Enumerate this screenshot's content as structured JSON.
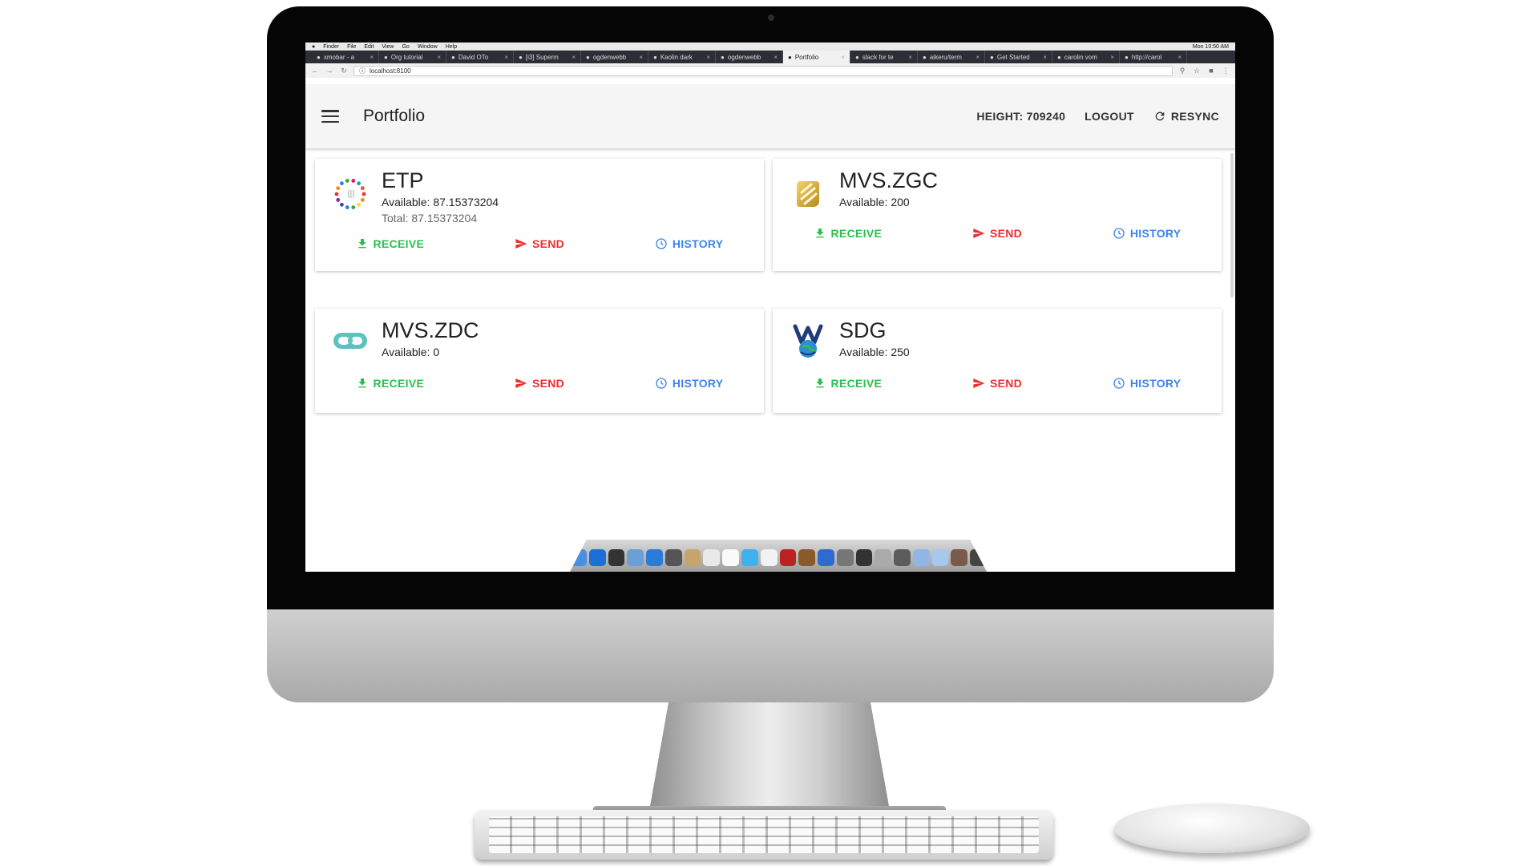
{
  "mac_menubar": {
    "items": [
      "Finder",
      "File",
      "Edit",
      "View",
      "Go",
      "Window",
      "Help"
    ],
    "clock": "Mon 10:50 AM"
  },
  "browser": {
    "tabs": [
      {
        "label": "xmobar - a"
      },
      {
        "label": "Org tutorial"
      },
      {
        "label": "David OTo"
      },
      {
        "label": "[i3] Superm"
      },
      {
        "label": "ogdenwebb"
      },
      {
        "label": "Kaolin dark"
      },
      {
        "label": "ogdenwebb"
      },
      {
        "label": "Portfolio"
      },
      {
        "label": "slack for te"
      },
      {
        "label": "aikeru/term"
      },
      {
        "label": "Get Started"
      },
      {
        "label": "carolin vom"
      },
      {
        "label": "http://carol"
      }
    ],
    "active_tab_index": 7,
    "url": "localhost:8100"
  },
  "app": {
    "title": "Portfolio",
    "height_label": "HEIGHT: 709240",
    "logout_label": "LOGOUT",
    "resync_label": "RESYNC"
  },
  "assets": [
    {
      "symbol": "ETP",
      "available": "Available: 87.15373204",
      "total": "Total: 87.15373204",
      "icon": "etp-logo-icon",
      "actions": {
        "receive": "RECEIVE",
        "send": "SEND",
        "history": "HISTORY"
      }
    },
    {
      "symbol": "MVS.ZGC",
      "available": "Available: 200",
      "icon": "zgc-logo-icon",
      "actions": {
        "receive": "RECEIVE",
        "send": "SEND",
        "history": "HISTORY"
      }
    },
    {
      "symbol": "MVS.ZDC",
      "available": "Available: 0",
      "icon": "zdc-logo-icon",
      "actions": {
        "receive": "RECEIVE",
        "send": "SEND",
        "history": "HISTORY"
      }
    },
    {
      "symbol": "SDG",
      "available": "Available: 250",
      "icon": "sdg-logo-icon",
      "actions": {
        "receive": "RECEIVE",
        "send": "SEND",
        "history": "HISTORY"
      }
    }
  ],
  "colors": {
    "receive": "#27c24c",
    "send": "#ef2d2d",
    "history": "#3b84f0",
    "appbar": "#f5f5f5",
    "browser_tabstrip": "#2d2d36"
  }
}
